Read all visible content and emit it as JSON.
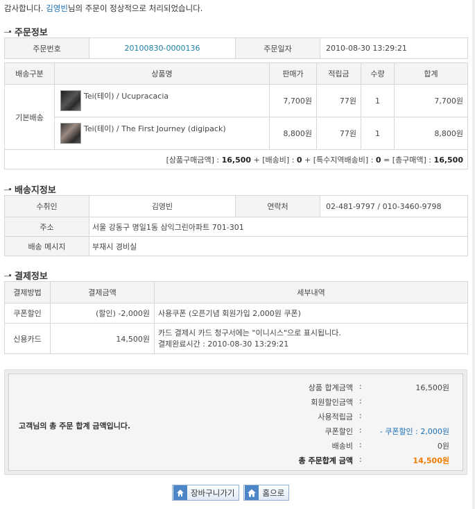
{
  "thanks": {
    "prefix": "감사합니다. ",
    "name": "김영빈",
    "suffix": "님의 주문이 정상적으로 처리되었습니다."
  },
  "order_section": {
    "title": "주문정보",
    "order_no_label": "주문번호",
    "order_no": "20100830-0000136",
    "order_date_label": "주문일자",
    "order_date": "2010-08-30 13:29:21"
  },
  "items_table": {
    "headers": [
      "배송구분",
      "상품명",
      "판매가",
      "적립금",
      "수량",
      "합계"
    ],
    "delivery_type": "기본배송",
    "rows": [
      {
        "name": "Tei(테이) / Ucupracacia",
        "price": "7,700원",
        "points": "77원",
        "qty": "1",
        "total": "7,700원"
      },
      {
        "name": "Tei(테이) / The First Journey (digipack)",
        "price": "8,800원",
        "points": "77원",
        "qty": "1",
        "total": "8,800원"
      }
    ],
    "summary": {
      "goods_label": "[상품구매금액] : ",
      "goods_value": "16,500",
      "ship_label": " + [배송비] : ",
      "ship_value": "0",
      "special_label": " + [특수지역배송비] : ",
      "special_value": "0",
      "total_label": " = [총구매액] : ",
      "total_value": "16,500"
    }
  },
  "shipping_section": {
    "title": "배송지정보",
    "receiver_label": "수취인",
    "receiver": "김영빈",
    "contact_label": "연락처",
    "contact": "02-481-9797 / 010-3460-9798",
    "address_label": "주소",
    "address": "서울 강동구 명일1동 삼익그린아파트 701-301",
    "message_label": "배송 메시지",
    "message": "부재시 경비실"
  },
  "payment_section": {
    "title": "결제정보",
    "headers": [
      "결제방법",
      "결제금액",
      "세부내역"
    ],
    "rows": [
      {
        "method": "쿠폰할인",
        "amount": "(할인) -2,000원",
        "detail1": "사용쿠폰 (오픈기념 회원가입 2,000원 쿠폰)",
        "detail2": ""
      },
      {
        "method": "신용카드",
        "amount": "14,500원",
        "detail1": "카드 결제시 카드 청구서에는 \"이니시스\"으로 표시됩니다.",
        "detail2": "결제완료시간 : 2010-08-30 13:29:21"
      }
    ]
  },
  "total_box": {
    "message": "고객님의 총 주문 합계 금액입니다.",
    "colon": ":",
    "lines": [
      {
        "label": "상품 합계금액",
        "value": "16,500원"
      },
      {
        "label": "회원할인금액",
        "value": ""
      },
      {
        "label": "사용적립금",
        "value": ""
      },
      {
        "label": "쿠폰할인",
        "value": "- 쿠폰할인 : 2,000원"
      },
      {
        "label": "배송비",
        "value": "0원"
      },
      {
        "label": "총 주문합계 금액",
        "value": "14,500원"
      }
    ]
  },
  "buttons": {
    "cart": "장바구니가기",
    "home": "홈으로"
  },
  "colors": {
    "link": "#1a6fb5",
    "accent": "#f07c00",
    "button_border": "#8fb0d2"
  },
  "icons": {
    "cart_button": "home-arrow-icon",
    "home_button": "house-icon"
  }
}
